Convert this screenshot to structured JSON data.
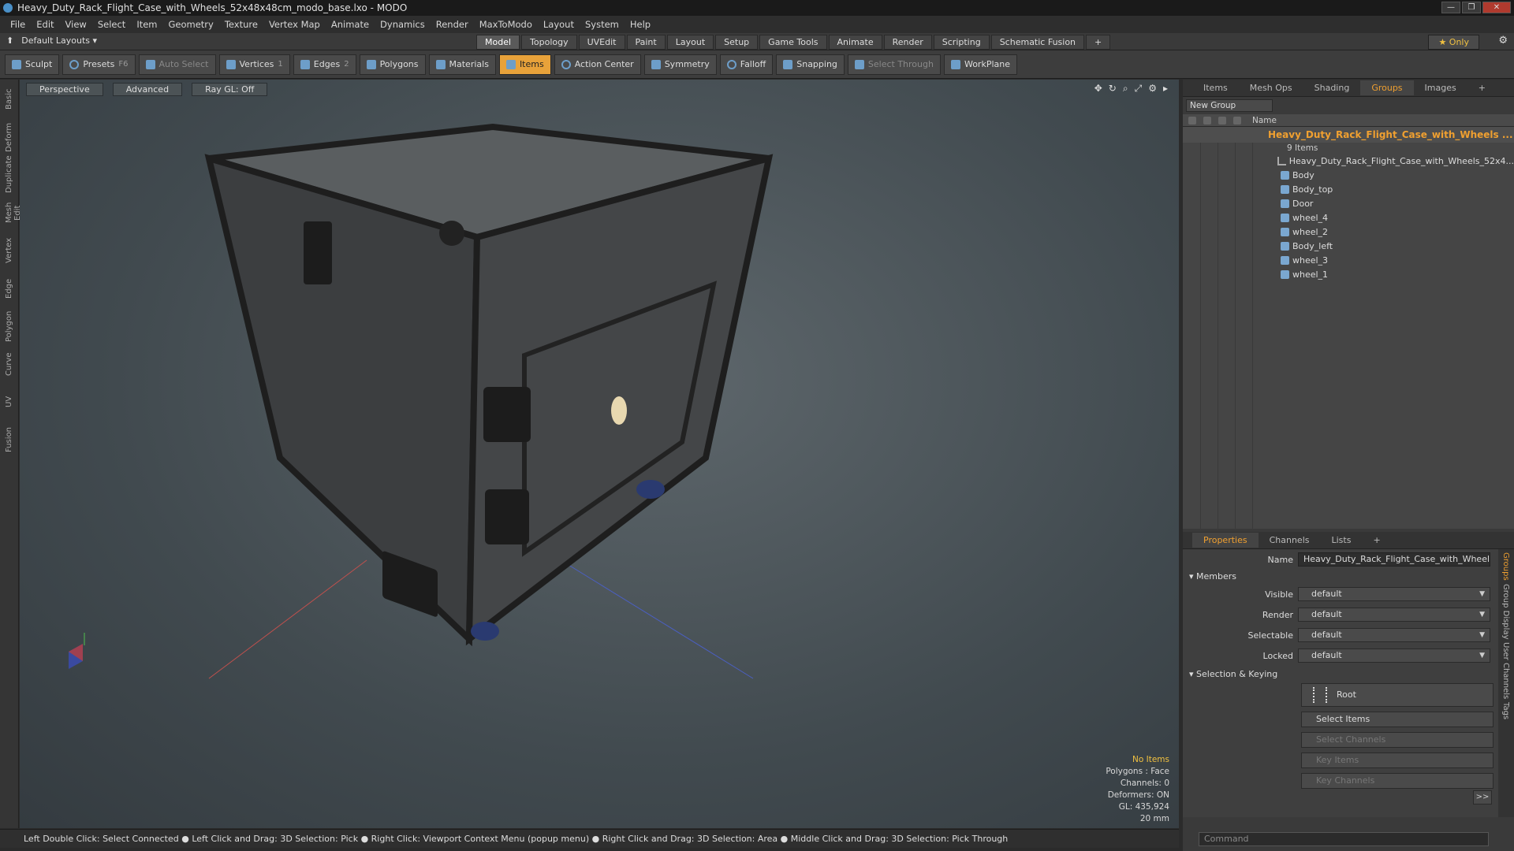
{
  "window": {
    "title": "Heavy_Duty_Rack_Flight_Case_with_Wheels_52x48x48cm_modo_base.lxo - MODO"
  },
  "menu": [
    "File",
    "Edit",
    "View",
    "Select",
    "Item",
    "Geometry",
    "Texture",
    "Vertex Map",
    "Animate",
    "Dynamics",
    "Render",
    "MaxToModo",
    "Layout",
    "System",
    "Help"
  ],
  "layout_bar": {
    "default_layouts": "Default Layouts ▾",
    "tabs": [
      "Model",
      "Topology",
      "UVEdit",
      "Paint",
      "Layout",
      "Setup",
      "Game Tools",
      "Animate",
      "Render",
      "Scripting",
      "Schematic Fusion"
    ],
    "only": "★  Only"
  },
  "toolbar": {
    "sculpt": "Sculpt",
    "presets": "Presets",
    "presets_key": "F6",
    "auto_select": "Auto Select",
    "vertices": "Vertices",
    "vertices_key": "1",
    "edges": "Edges",
    "edges_key": "2",
    "polygons": "Polygons",
    "materials": "Materials",
    "items": "Items",
    "action_center": "Action Center",
    "symmetry": "Symmetry",
    "falloff": "Falloff",
    "snapping": "Snapping",
    "select_through": "Select Through",
    "workplane": "WorkPlane"
  },
  "left_tabs": [
    "Basic",
    "Deform",
    "Duplicate",
    "Mesh Edit",
    "Vertex",
    "Edge",
    "Polygon",
    "Curve",
    "UV",
    "Fusion"
  ],
  "viewport": {
    "perspective": "Perspective",
    "advanced": "Advanced",
    "raygl": "Ray GL: Off",
    "stats": {
      "no_items": "No Items",
      "polygons": "Polygons : Face",
      "channels": "Channels: 0",
      "deformers": "Deformers: ON",
      "gl": "GL: 435,924",
      "size": "20 mm"
    }
  },
  "status": "Left Double Click: Select Connected ● Left Click and Drag: 3D Selection: Pick ● Right Click: Viewport Context Menu (popup menu) ● Right Click and Drag: 3D Selection: Area ● Middle Click and Drag: 3D Selection: Pick Through",
  "groups_panel": {
    "tabs": [
      "Items",
      "Mesh Ops",
      "Shading",
      "Groups",
      "Images"
    ],
    "new_group": "New Group",
    "name_col": "Name",
    "group_name": "Heavy_Duty_Rack_Flight_Case_with_Wheels ...",
    "group_count": "9 Items",
    "items": [
      {
        "name": "Heavy_Duty_Rack_Flight_Case_with_Wheels_52x4...",
        "icon": "locator-icon"
      },
      {
        "name": "Body",
        "icon": "mesh-icon"
      },
      {
        "name": "Body_top",
        "icon": "mesh-icon"
      },
      {
        "name": "Door",
        "icon": "mesh-icon"
      },
      {
        "name": "wheel_4",
        "icon": "mesh-icon"
      },
      {
        "name": "wheel_2",
        "icon": "mesh-icon"
      },
      {
        "name": "Body_left",
        "icon": "mesh-icon"
      },
      {
        "name": "wheel_3",
        "icon": "mesh-icon"
      },
      {
        "name": "wheel_1",
        "icon": "mesh-icon"
      }
    ]
  },
  "properties": {
    "tabs": [
      "Properties",
      "Channels",
      "Lists"
    ],
    "name_label": "Name",
    "name_value": "Heavy_Duty_Rack_Flight_Case_with_Wheels_5",
    "members": "Members",
    "visible_label": "Visible",
    "visible": "default",
    "render_label": "Render",
    "render": "default",
    "selectable_label": "Selectable",
    "selectable": "default",
    "locked_label": "Locked",
    "locked": "default",
    "selection_keying": "Selection & Keying",
    "root": "Root",
    "select_items": "Select Items",
    "select_channels": "Select Channels",
    "key_items": "Key Items",
    "key_channels": "Key Channels",
    "more": ">>",
    "command_placeholder": "Command",
    "side_tabs": [
      "Groups",
      "Group Display",
      "User Channels",
      "Tags"
    ]
  },
  "colors": {
    "accent": "#e8a23a",
    "active_text": "#f0a030",
    "bg": "#3a3a3a"
  }
}
